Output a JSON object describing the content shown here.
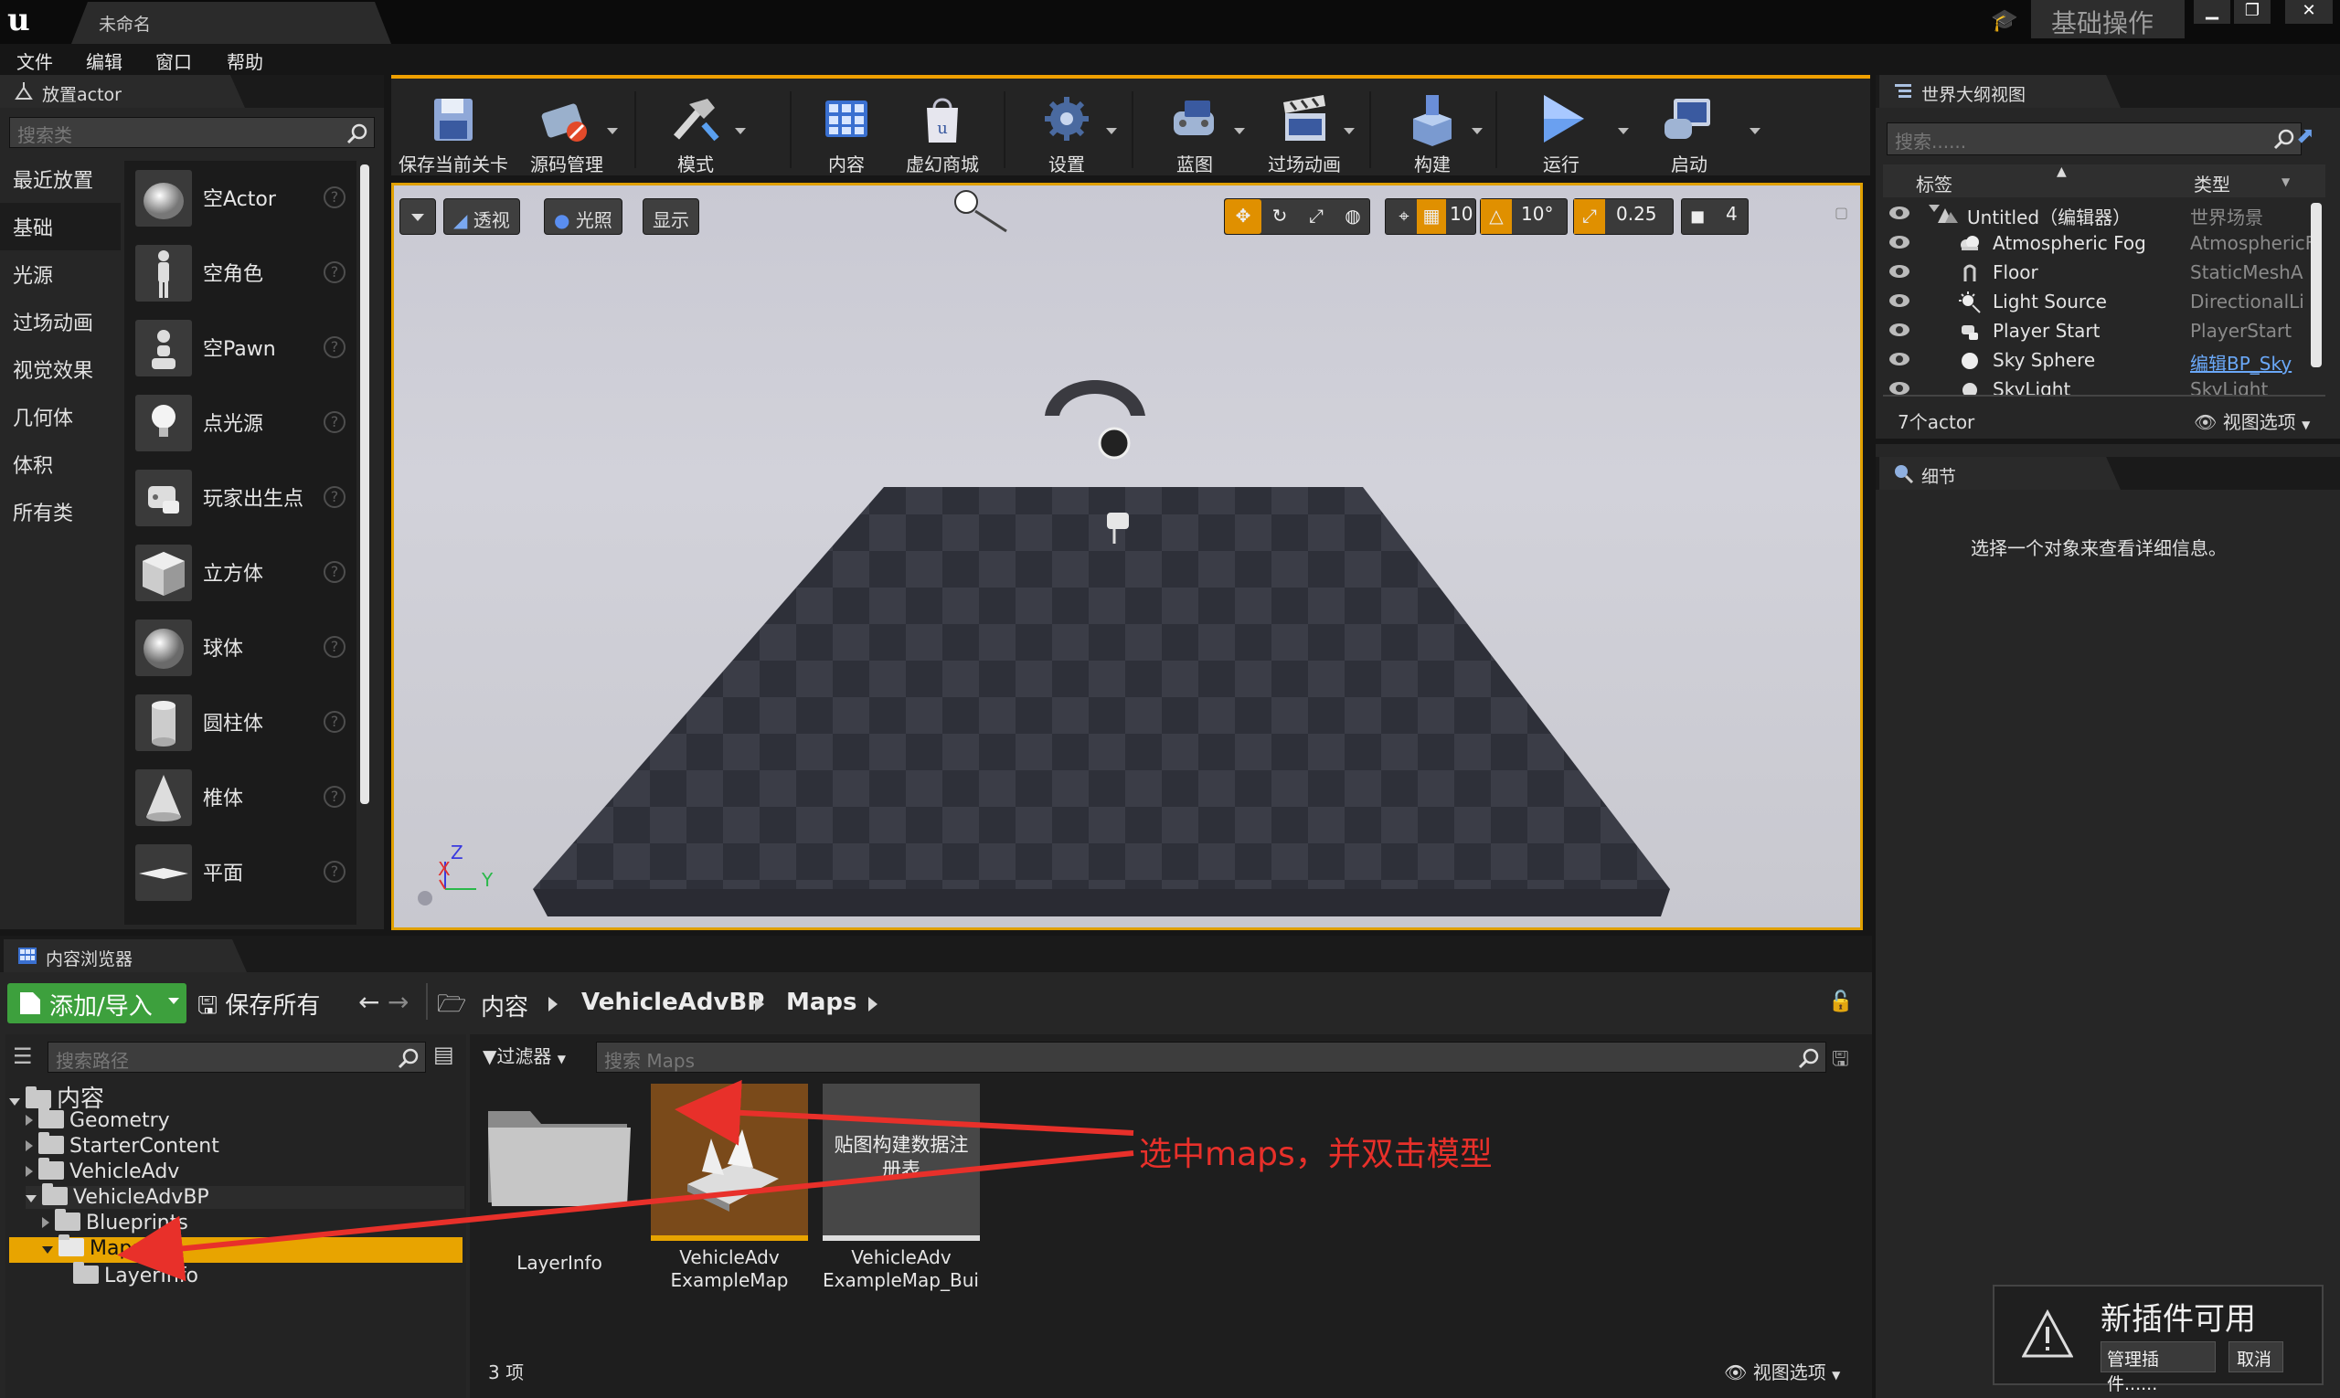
{
  "window": {
    "doc_tab": "未命名",
    "layout_preset": "基础操作",
    "min": "▁",
    "max": "❐",
    "close": "✕"
  },
  "menu": [
    "文件",
    "编辑",
    "窗口",
    "帮助"
  ],
  "place_actors": {
    "tab": "放置actor",
    "search_placeholder": "搜索类",
    "categories": [
      "最近放置",
      "基础",
      "光源",
      "过场动画",
      "视觉效果",
      "几何体",
      "体积",
      "所有类"
    ],
    "active_category": "基础",
    "items": [
      "空Actor",
      "空角色",
      "空Pawn",
      "点光源",
      "玩家出生点",
      "立方体",
      "球体",
      "圆柱体",
      "椎体",
      "平面"
    ]
  },
  "toolbar": [
    {
      "label": "保存当前关卡",
      "icon": "save-icon"
    },
    {
      "label": "源码管理",
      "icon": "source-control-icon"
    },
    {
      "label": "模式",
      "icon": "modes-icon"
    },
    {
      "label": "内容",
      "icon": "content-icon"
    },
    {
      "label": "虚幻商城",
      "icon": "marketplace-icon"
    },
    {
      "label": "设置",
      "icon": "settings-icon"
    },
    {
      "label": "蓝图",
      "icon": "blueprint-icon"
    },
    {
      "label": "过场动画",
      "icon": "cinematics-icon"
    },
    {
      "label": "构建",
      "icon": "build-icon"
    },
    {
      "label": "运行",
      "icon": "play-icon"
    },
    {
      "label": "启动",
      "icon": "launch-icon"
    }
  ],
  "viewport": {
    "perspective": "透视",
    "lit": "光照",
    "show": "显示",
    "grid_snap": "10",
    "rotation_snap": "10°",
    "scale_snap": "0.25",
    "camera_speed": "4",
    "axis_z": "Z",
    "axis_x": "X",
    "axis_y": "Y",
    "colors": {
      "accent": "#e0a000",
      "floor_dark": "#2b2d36",
      "floor_light": "#3a3c46"
    }
  },
  "outliner": {
    "tab": "世界大纲视图",
    "search_placeholder": "搜索......",
    "col_label": "标签",
    "col_type": "类型",
    "rows": [
      {
        "name": "Untitled（编辑器）",
        "type": "世界场景"
      },
      {
        "name": "Atmospheric Fog",
        "type": "AtmosphericF"
      },
      {
        "name": "Floor",
        "type": "StaticMeshA"
      },
      {
        "name": "Light Source",
        "type": "DirectionalLi"
      },
      {
        "name": "Player Start",
        "type": "PlayerStart"
      },
      {
        "name": "Sky Sphere",
        "type": "编辑BP_Sky"
      },
      {
        "name": "SkyLight",
        "type": "SkyLight"
      }
    ],
    "count": "7个actor",
    "view_options": "视图选项"
  },
  "details": {
    "tab": "细节",
    "empty_message": "选择一个对象来查看详细信息。"
  },
  "content_browser": {
    "tab": "内容浏览器",
    "add_import": "添加/导入",
    "save_all": "保存所有",
    "breadcrumb": [
      "内容",
      "VehicleAdvBP",
      "Maps"
    ],
    "path_search_placeholder": "搜索路径",
    "filters": "过滤器",
    "asset_search_placeholder": "搜索 Maps",
    "tree": {
      "root": "内容",
      "children": [
        "Geometry",
        "StarterContent",
        "VehicleAdv",
        "VehicleAdvBP"
      ],
      "vehicleadvbp_children": [
        "Blueprints",
        "Maps"
      ],
      "maps_children": [
        "LayerInfo"
      ]
    },
    "assets": [
      {
        "name": "LayerInfo",
        "kind": "folder"
      },
      {
        "name": "VehicleAdv ExampleMap",
        "kind": "map",
        "selected": true
      },
      {
        "name": "VehicleAdv ExampleMap_BuiltData",
        "thumb_text": "贴图构建数据注册表",
        "kind": "data"
      }
    ],
    "count": "3 项",
    "view_options": "视图选项"
  },
  "annotation": {
    "text": "选中maps，并双击模型",
    "color": "#e8302a"
  },
  "notification": {
    "title": "新插件可用",
    "manage": "管理插件......",
    "cancel": "取消"
  }
}
